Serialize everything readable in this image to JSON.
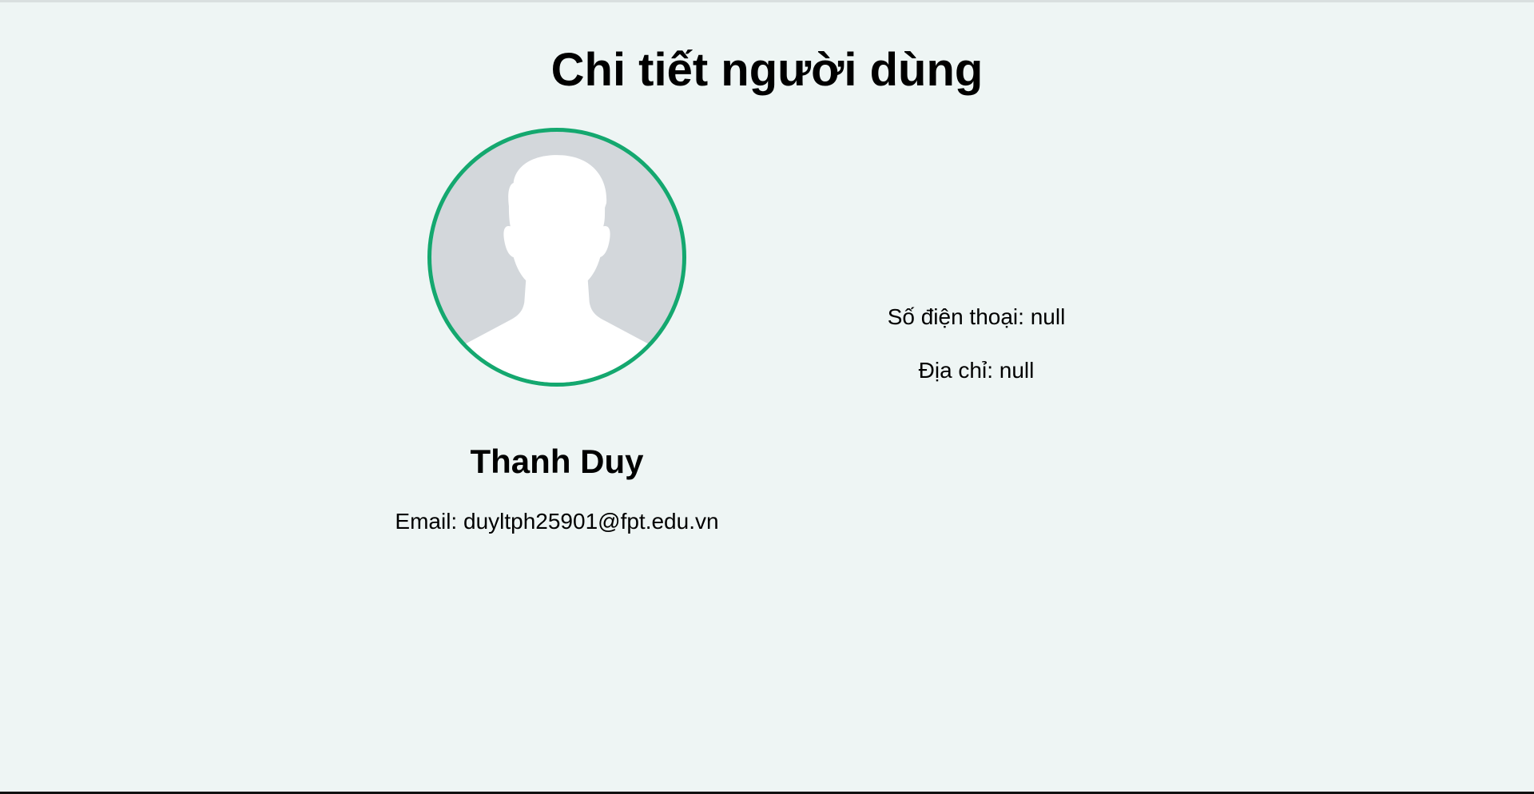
{
  "page": {
    "title": "Chi tiết người dùng",
    "background": "#eef5f4",
    "accent": "#14a86f"
  },
  "profile": {
    "avatar_icon": "default-user-silhouette-icon",
    "name": "Thanh Duy",
    "email_label": "Email:",
    "email_value": "duyltph25901@fpt.edu.vn"
  },
  "details": {
    "phone_label": "Số điện thoại:",
    "phone_value": "null",
    "address_label": "Địa chỉ:",
    "address_value": "null"
  }
}
